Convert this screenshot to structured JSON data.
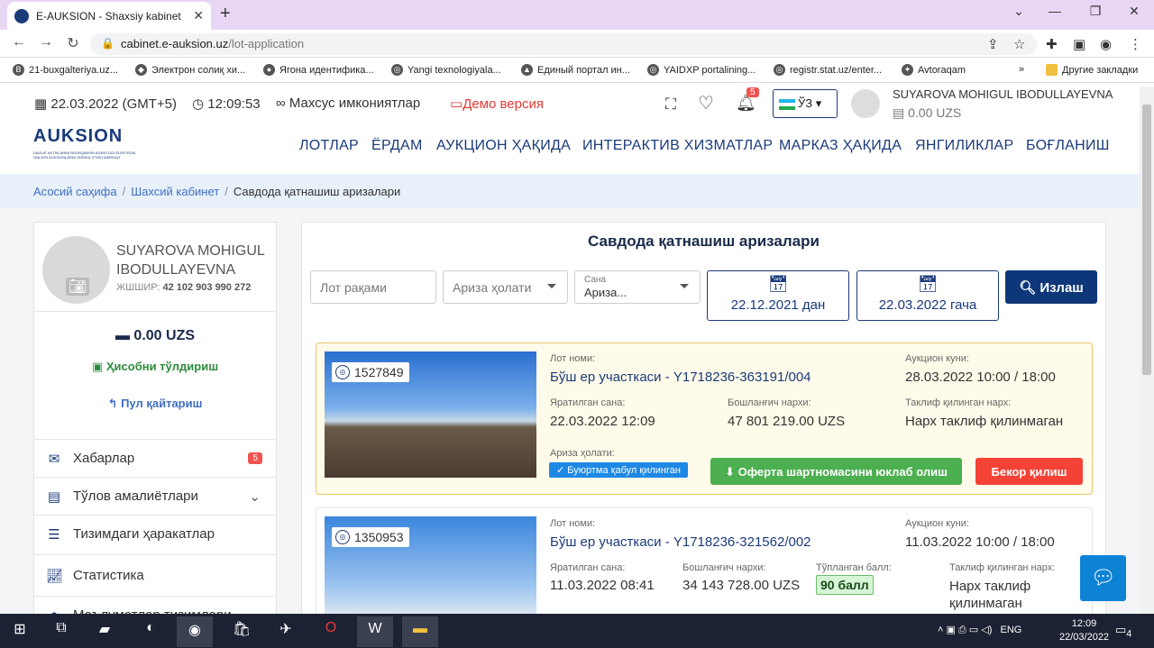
{
  "browser": {
    "tab_title": "E-AUKSION - Shaxsiy kabinet",
    "url_host": "cabinet.e-auksion.uz",
    "url_path": "/lot-application",
    "bookmarks": [
      "21-buxgalteriya.uz...",
      "Электрон солиқ хи...",
      "Ягона идентифика...",
      "Yangi texnologiyala...",
      "Единый портал ин...",
      "YAIDXP portalining...",
      "registr.stat.uz/enter...",
      "Avtoraqam"
    ],
    "other_bookmarks": "Другие закладки"
  },
  "topbar": {
    "date": "22.03.2022 (GMT+5)",
    "time": "12:09:53",
    "accessibility": "Махсус имкониятлар",
    "demo": "Демо версия",
    "notif_count": "5",
    "lang": "ЎЗ",
    "user_name": "SUYAROVA MOHIGUL IBODULLAYEVNA",
    "balance": "0.00 UZS"
  },
  "logo": {
    "word": "AUKSION",
    "sub": "DAVLAT AKTIVLARINI BOSHQARISH AGENTLIGI ELEKTRON-ONLAYN AUKSIONLARNI TASHKIL ETISH MARKAZI"
  },
  "nav": [
    "ЛОТЛАР",
    "ЁРДАМ",
    "АУКЦИОН ҲАҚИДА",
    "ИНТЕРАКТИВ ХИЗМАТЛАР",
    "МАРКАЗ ҲАҚИДА",
    "ЯНГИЛИКЛАР",
    "БОҒЛАНИШ"
  ],
  "breadcrumb": {
    "home": "Асосий саҳифа",
    "cabinet": "Шахсий кабинет",
    "current": "Савдода қатнашиш аризалари"
  },
  "profile": {
    "name": "SUYAROVA MOHIGUL IBODULLAYEVNA",
    "jshir_label": "ЖШШИР:",
    "jshir": "42 102 903 990 272",
    "balance": "0.00 UZS",
    "topup": "Ҳисобни тўлдириш",
    "refund": "Пул қайтариш",
    "menu": [
      "Хабарлар",
      "Тўлов амалиётлари",
      "Тизимдаги ҳаракатлар",
      "Статистика",
      "Маълумотлар тизимлари"
    ],
    "messages_count": "5"
  },
  "main": {
    "title": "Савдода қатнашиш аризалари",
    "lot_placeholder": "Лот рақами",
    "status_select": "Ариза ҳолати",
    "type_small": "Сана",
    "type_value": "Ариза...",
    "date_from": "22.12.2021 дан",
    "date_to": "22.03.2022 гача",
    "search": "Излаш"
  },
  "labels": {
    "lot_name": "Лот номи:",
    "auction_date": "Аукцион куни:",
    "created": "Яратилган сана:",
    "start_price": "Бошланғич нархи:",
    "offered_price": "Таклиф қилинган нарх:",
    "status": "Ариза ҳолати:",
    "score": "Тўпланган балл:"
  },
  "lots": [
    {
      "id": "1527849",
      "name": "Бўш ер участкаси - Y1718236-363191/004",
      "auction": "28.03.2022 10:00 / 18:00",
      "created": "22.03.2022 12:09",
      "price": "47 801 219.00 UZS",
      "offered": "Нарх таклиф қилинмаган",
      "status": "Буюртма қабул қилинган",
      "oferta": "Оферта шартномасини юклаб олиш",
      "cancel": "Бекор қилиш"
    },
    {
      "id": "1350953",
      "name": "Бўш ер участкаси - Y1718236-321562/002",
      "auction": "11.03.2022 10:00 / 18:00",
      "created": "11.03.2022 08:41",
      "price": "34 143 728.00 UZS",
      "score": "90 балл",
      "offered": "Нарх таклиф қилинмаган"
    }
  ],
  "taskbar": {
    "lang": "ENG",
    "time": "12:09",
    "date": "22/03/2022",
    "notif": "4"
  }
}
